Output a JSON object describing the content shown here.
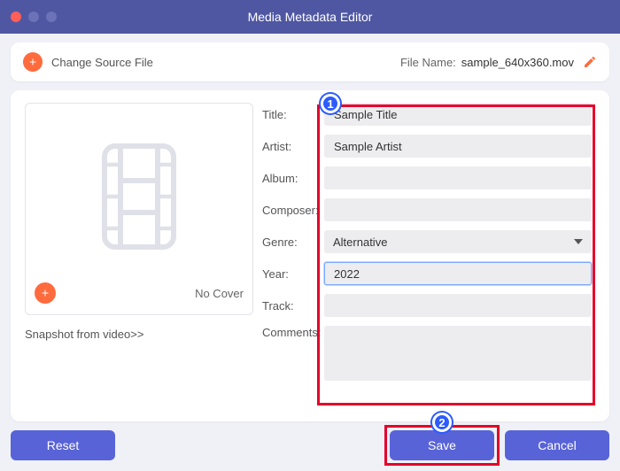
{
  "window": {
    "title": "Media Metadata Editor"
  },
  "header": {
    "change_source": "Change Source File",
    "file_name_label": "File Name:",
    "file_name_value": "sample_640x360.mov"
  },
  "cover": {
    "no_cover": "No Cover",
    "snapshot": "Snapshot from video>>"
  },
  "labels": {
    "title": "Title:",
    "artist": "Artist:",
    "album": "Album:",
    "composer": "Composer:",
    "genre": "Genre:",
    "year": "Year:",
    "track": "Track:",
    "comments": "Comments:"
  },
  "fields": {
    "title": "Sample Title",
    "artist": "Sample Artist",
    "album": "",
    "composer": "",
    "genre": "Alternative",
    "year": "2022",
    "track": "",
    "comments": ""
  },
  "buttons": {
    "reset": "Reset",
    "save": "Save",
    "cancel": "Cancel"
  },
  "markers": {
    "one": "1",
    "two": "2"
  }
}
